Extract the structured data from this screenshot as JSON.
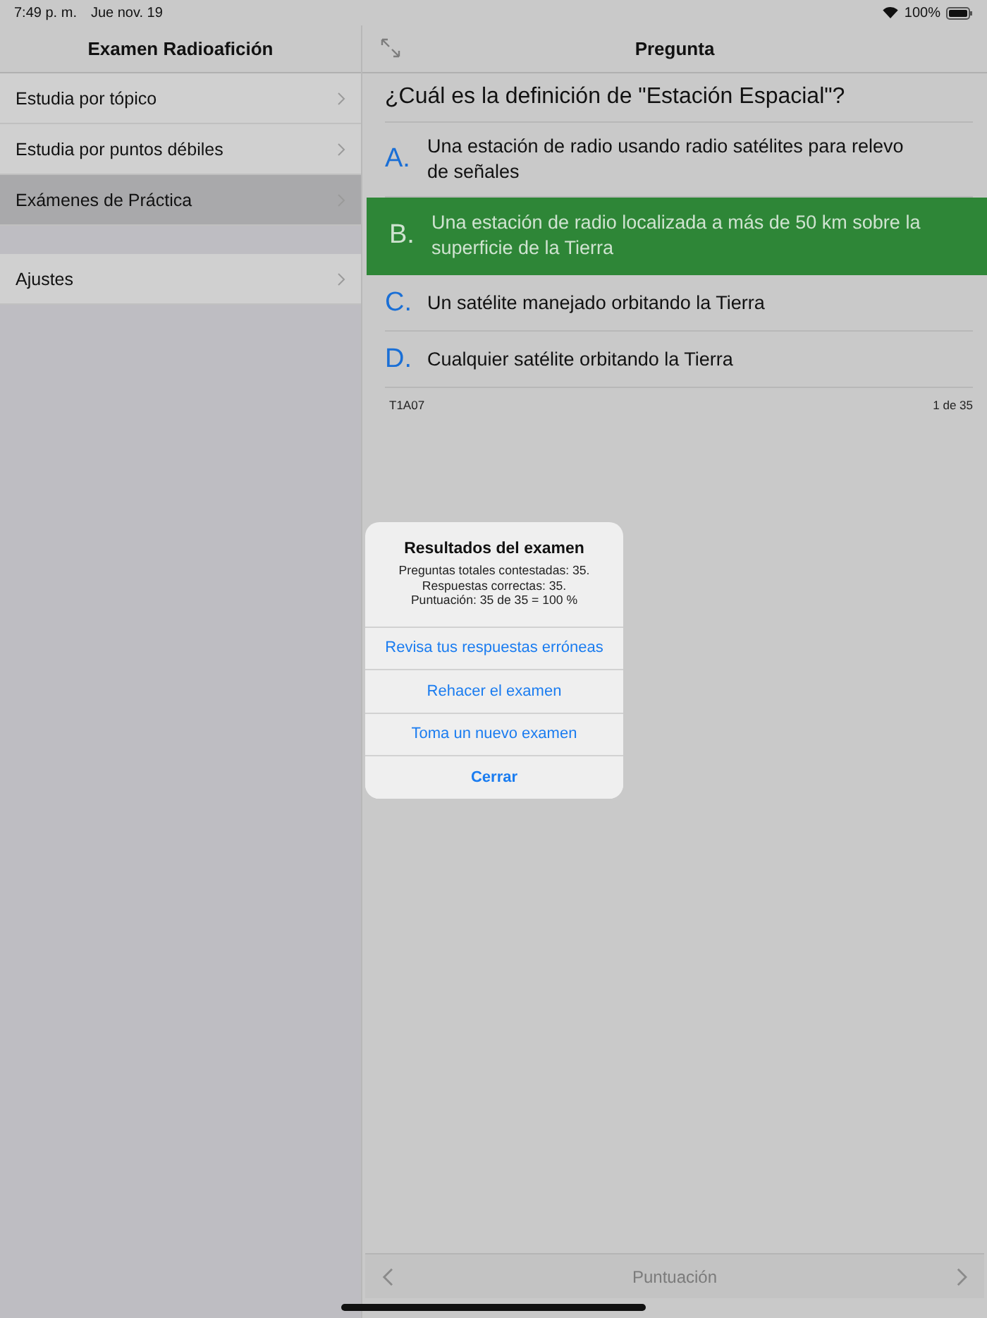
{
  "status_bar": {
    "time": "7:49 p. m.",
    "date": "Jue nov. 19",
    "battery": "100%"
  },
  "sidebar": {
    "title": "Examen Radioafición",
    "groups": [
      {
        "items": [
          {
            "label": "Estudia por tópico",
            "selected": false
          },
          {
            "label": "Estudia por puntos débiles",
            "selected": false
          },
          {
            "label": "Exámenes de Práctica",
            "selected": true
          }
        ]
      },
      {
        "items": [
          {
            "label": "Ajustes",
            "selected": false
          }
        ]
      }
    ]
  },
  "detail": {
    "title": "Pregunta",
    "question": "¿Cuál es la definición de \"Estación Espacial\"?",
    "answers": [
      {
        "letter": "A.",
        "text": "Una estación de radio usando radio satélites para relevo de señales",
        "selected": false
      },
      {
        "letter": "B.",
        "text": "Una estación de radio localizada a más de 50 km sobre la superficie de la Tierra",
        "selected": true
      },
      {
        "letter": "C.",
        "text": "Un satélite manejado orbitando la Tierra",
        "selected": false
      },
      {
        "letter": "D.",
        "text": "Cualquier satélite orbitando la Tierra",
        "selected": false
      }
    ],
    "code": "T1A07",
    "position": "1 de 35",
    "toolbar": {
      "label": "Puntuación"
    }
  },
  "alert": {
    "title": "Resultados del examen",
    "message": [
      "Preguntas totales contestadas: 35.",
      "Respuestas correctas: 35.",
      "Puntuación: 35 de 35 = 100 %"
    ],
    "actions": [
      {
        "label": "Revisa tus respuestas erróneas",
        "bold": false
      },
      {
        "label": "Rehacer el examen",
        "bold": false
      },
      {
        "label": "Toma un nuevo examen",
        "bold": false
      },
      {
        "label": "Cerrar",
        "bold": true
      }
    ]
  }
}
